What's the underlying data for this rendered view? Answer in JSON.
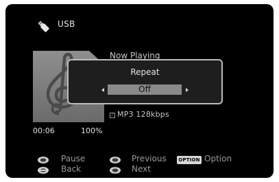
{
  "header": {
    "source_icon": "usb-plug-icon",
    "source_label": "USB"
  },
  "track": {
    "status": "Now Playing",
    "album_art_icon": "treble-clef-icon",
    "format_icon": "music-file-icon",
    "format": "MP3 128kbps",
    "elapsed": "00:06",
    "progress": "100%"
  },
  "popup": {
    "title": "Repeat",
    "value": "Off",
    "left_arrow_icon": "arrow-left-icon",
    "right_arrow_icon": "arrow-right-icon"
  },
  "controls": {
    "enter_icon": "enter-button-icon",
    "pause_label": "Pause",
    "back_icon": "back-button-icon",
    "back_label": "Back",
    "up_down_icon": "up-down-button-icon",
    "previous_label": "Previous",
    "next_icon": "next-button-icon",
    "next_label": "Next",
    "option_key_label": "OPTION",
    "option_label": "Option"
  },
  "colors": {
    "screen_background": "#000000",
    "popup_background": "#1e1e1e",
    "popup_border": "#bcbcbc",
    "selected_value_background": "#8a8a8a",
    "text": "#d8d8d8",
    "hint_text": "#9a9a9a"
  }
}
